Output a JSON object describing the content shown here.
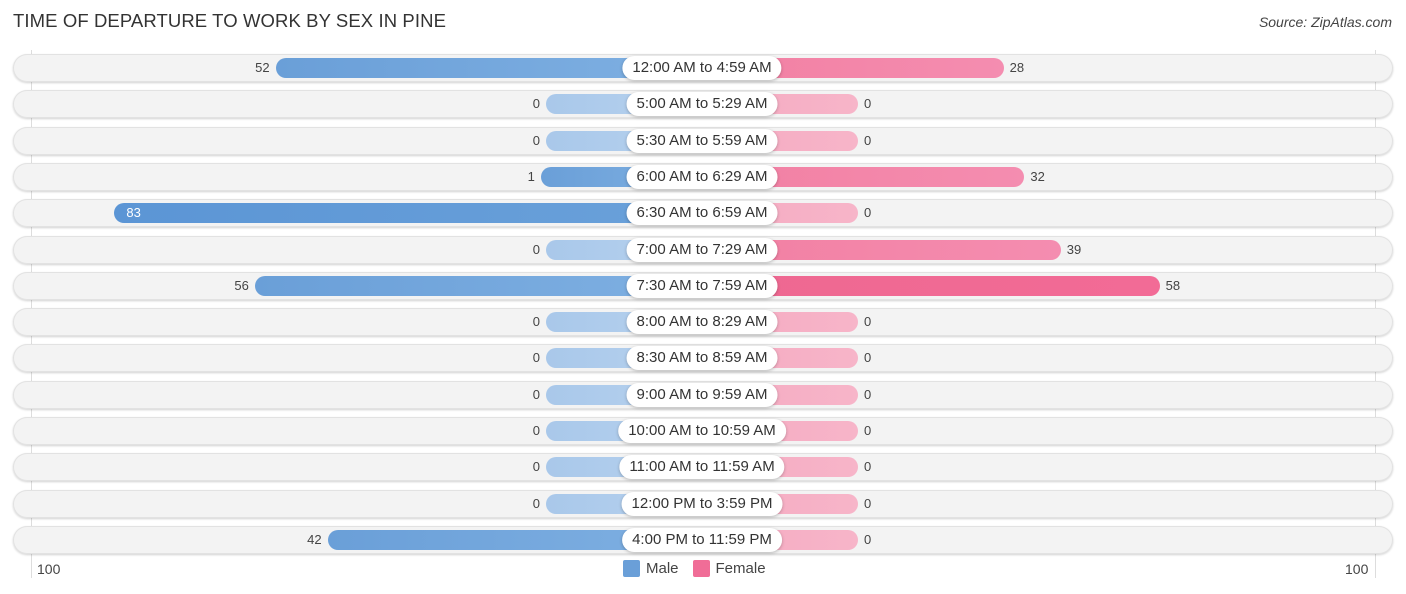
{
  "header": {
    "title": "TIME OF DEPARTURE TO WORK BY SEX IN PINE",
    "source": "Source: ZipAtlas.com"
  },
  "colors": {
    "male": "#6a9fd8",
    "female": "#f27fa2"
  },
  "chart_data": {
    "type": "bar",
    "orientation": "horizontal-diverging",
    "title": "TIME OF DEPARTURE TO WORK BY SEX IN PINE",
    "categories": [
      "12:00 AM to 4:59 AM",
      "5:00 AM to 5:29 AM",
      "5:30 AM to 5:59 AM",
      "6:00 AM to 6:29 AM",
      "6:30 AM to 6:59 AM",
      "7:00 AM to 7:29 AM",
      "7:30 AM to 7:59 AM",
      "8:00 AM to 8:29 AM",
      "8:30 AM to 8:59 AM",
      "9:00 AM to 9:59 AM",
      "10:00 AM to 10:59 AM",
      "11:00 AM to 11:59 AM",
      "12:00 PM to 3:59 PM",
      "4:00 PM to 11:59 PM"
    ],
    "series": [
      {
        "name": "Male",
        "values": [
          52,
          0,
          0,
          1,
          83,
          0,
          56,
          0,
          0,
          0,
          0,
          0,
          0,
          42
        ]
      },
      {
        "name": "Female",
        "values": [
          28,
          0,
          0,
          32,
          0,
          39,
          58,
          0,
          0,
          0,
          0,
          0,
          0,
          0
        ]
      }
    ],
    "axis": {
      "left_label": "100",
      "right_label": "100",
      "range": [
        0,
        100
      ]
    },
    "legend": {
      "items": [
        "Male",
        "Female"
      ],
      "placement": "bottom-center"
    },
    "grid": false
  }
}
